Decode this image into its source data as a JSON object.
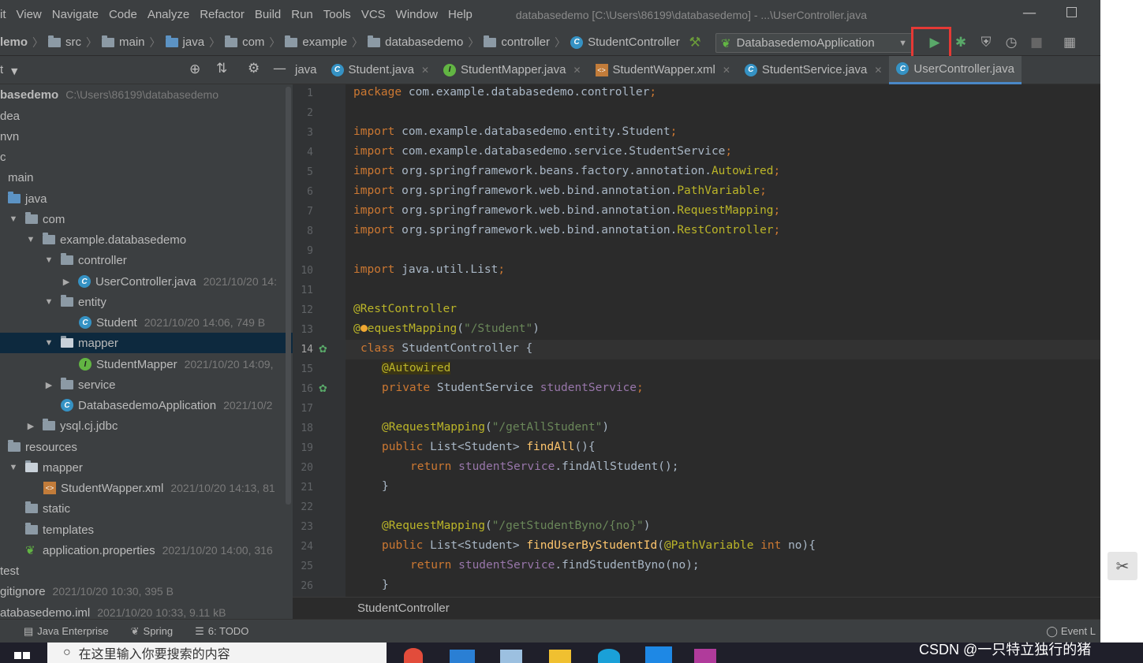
{
  "menu": [
    "it",
    "View",
    "Navigate",
    "Code",
    "Analyze",
    "Refactor",
    "Build",
    "Run",
    "Tools",
    "VCS",
    "Window",
    "Help"
  ],
  "window_title": "databasedemo [C:\\Users\\86199\\databasedemo] - ...\\UserController.java",
  "nav": {
    "crumbs": [
      "lemo",
      "src",
      "main",
      "java",
      "com",
      "example",
      "databasedemo",
      "controller",
      "StudentController"
    ],
    "run_config": "DatabasedemoApplication"
  },
  "project": {
    "header_label": "t",
    "rows": [
      {
        "text": "basedemo",
        "meta": "C:\\Users\\86199\\databasedemo"
      },
      {
        "text": "dea",
        "meta": ""
      },
      {
        "text": "nvn",
        "meta": ""
      },
      {
        "text": "c",
        "meta": ""
      },
      {
        "text": "main",
        "meta": ""
      },
      {
        "text": "java",
        "meta": ""
      },
      {
        "text": "com",
        "meta": ""
      },
      {
        "text": "example.databasedemo",
        "meta": ""
      },
      {
        "text": "controller",
        "meta": ""
      },
      {
        "text": "UserController.java",
        "meta": "2021/10/20 14:"
      },
      {
        "text": "entity",
        "meta": ""
      },
      {
        "text": "Student",
        "meta": "2021/10/20 14:06, 749 B"
      },
      {
        "text": "mapper",
        "meta": ""
      },
      {
        "text": "StudentMapper",
        "meta": "2021/10/20 14:09,"
      },
      {
        "text": "service",
        "meta": ""
      },
      {
        "text": "DatabasedemoApplication",
        "meta": "2021/10/2"
      },
      {
        "text": "ysql.cj.jdbc",
        "meta": ""
      },
      {
        "text": "resources",
        "meta": ""
      },
      {
        "text": "mapper",
        "meta": ""
      },
      {
        "text": "StudentWapper.xml",
        "meta": "2021/10/20 14:13, 81"
      },
      {
        "text": "static",
        "meta": ""
      },
      {
        "text": "templates",
        "meta": ""
      },
      {
        "text": "application.properties",
        "meta": "2021/10/20 14:00, 316"
      },
      {
        "text": "test",
        "meta": ""
      },
      {
        "text": "gitignore",
        "meta": "2021/10/20 10:30, 395 B"
      },
      {
        "text": "atabasedemo.iml",
        "meta": "2021/10/20 10:33, 9.11 kB"
      }
    ]
  },
  "tabs": [
    {
      "label": "java",
      "close": ""
    },
    {
      "label": "Student.java",
      "close": "✕"
    },
    {
      "label": "StudentMapper.java",
      "close": "✕"
    },
    {
      "label": "StudentWapper.xml",
      "close": "✕"
    },
    {
      "label": "StudentService.java",
      "close": "✕"
    },
    {
      "label": "UserController.java",
      "close": ""
    }
  ],
  "line_numbers": [
    "1",
    "2",
    "3",
    "4",
    "5",
    "6",
    "7",
    "8",
    "9",
    "10",
    "11",
    "12",
    "13",
    "14",
    "15",
    "16",
    "17",
    "18",
    "19",
    "20",
    "21",
    "22",
    "23",
    "24",
    "25",
    "26"
  ],
  "code": {
    "l1a": "package ",
    "l1b": "com.example.databasedemo.controller",
    "l3b": "com.example.databasedemo.entity.Student",
    "l4b": "com.example.databasedemo.service.StudentService",
    "l5b": "org.springframework.beans.factory.annotation.",
    "l5c": "Autowired",
    "l6b": "org.springframework.web.bind.annotation.",
    "l6c": "PathVariable",
    "l7b": "org.springframework.web.bind.annotation.",
    "l7c": "RequestMapping",
    "l8b": "org.springframework.web.bind.annotation.",
    "l8c": "RestController",
    "l10b": "java.util.List",
    "import": "import ",
    "semi": ";",
    "l12": "@RestController",
    "l13a": "@",
    "l13b": "equestMapping",
    "l13c": "(",
    "l13d": "\"/Student\"",
    "l13e": ")",
    "l14a": "class ",
    "l14b": "StudentController {",
    "l15": "@Autowired",
    "l16a": "private ",
    "l16b": "StudentService ",
    "l16c": "studentService",
    "l18a": "@RequestMapping",
    "l18b": "(",
    "l18c": "\"/getAllStudent\"",
    "l18d": ")",
    "l19a": "public ",
    "l19b": "List<Student> ",
    "l19c": "findAll",
    "l19d": "(){",
    "l20a": "return ",
    "l20b": "studentService",
    ".l20c": "",
    "l20c": ".findAllStudent();",
    "l21": "}",
    "l23a": "@RequestMapping",
    "l23b": "(",
    "l23c": "\"/getStudentByno/{no}\"",
    "l23d": ")",
    "l24a": "public ",
    "l24b": "List<Student> ",
    "l24c": "findUserByStudentId",
    "l24d": "(",
    "l24e": "@PathVariable ",
    "l24f": "int ",
    "l24g": "no){",
    "l25a": "return ",
    "l25b": "studentService",
    "l25c": ".findStudentByno(no);",
    "l26": "}"
  },
  "editor_breadcrumb": "StudentController",
  "status": {
    "java_ee": "Java Enterprise",
    "spring": "Spring",
    "todo": "6: TODO",
    "event": "Event L"
  },
  "taskbar": {
    "search_placeholder": "在这里输入你要搜索的内容"
  },
  "watermark": "CSDN @一只特立独行的猪 ​ ​"
}
